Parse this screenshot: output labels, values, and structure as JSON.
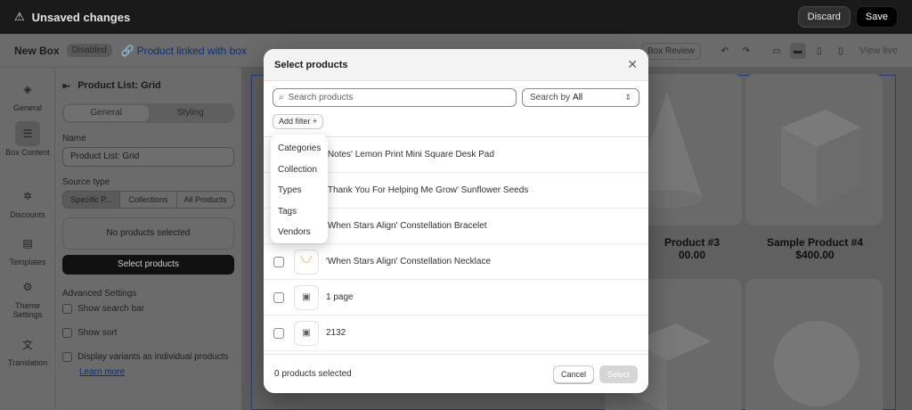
{
  "topbar": {
    "title": "Unsaved changes",
    "discard": "Discard",
    "save": "Save"
  },
  "subbar": {
    "box_name": "New Box",
    "status_badge": "Disabled",
    "product_link": "Product linked with box",
    "box_review": "Box Review",
    "view_live": "View live"
  },
  "rail": [
    {
      "label": "General",
      "icon": "cube-icon"
    },
    {
      "label": "Box Content",
      "icon": "list-icon"
    },
    {
      "label": "Discounts",
      "icon": "discount-icon"
    },
    {
      "label": "Templates",
      "icon": "template-icon"
    },
    {
      "label": "Theme Settings",
      "icon": "gear-icon"
    },
    {
      "label": "Translation",
      "icon": "translate-icon"
    }
  ],
  "panel": {
    "title": "Product List: Grid",
    "tabs": [
      "General",
      "Styling"
    ],
    "name_label": "Name",
    "name_value": "Product List: Grid",
    "source_label": "Source type",
    "source_options": [
      "Specific P...",
      "Collections",
      "All Products"
    ],
    "empty_text": "No products selected",
    "select_button": "Select products",
    "advanced_label": "Advanced Settings",
    "options": [
      "Show search bar",
      "Show sort",
      "Display variants as individual products"
    ],
    "learn_more": "Learn more"
  },
  "preview": {
    "cards": [
      {
        "name": "Product #3",
        "price": "00.00"
      },
      {
        "name": "Sample Product #4",
        "price": "$400.00"
      }
    ]
  },
  "modal": {
    "title": "Select products",
    "search_placeholder": "Search products",
    "search_by_label": "Search by",
    "search_by_value": "All",
    "add_filter": "Add filter +",
    "products": [
      "'Notes' Lemon Print Mini Square Desk Pad",
      "'Thank You For Helping Me Grow' Sunflower Seeds",
      "'When Stars Align' Constellation Bracelet",
      "'When Stars Align' Constellation Necklace",
      "1 page",
      "2132"
    ],
    "selected_count": "0 products selected",
    "cancel": "Cancel",
    "select": "Select"
  },
  "filter_menu": [
    "Categories",
    "Collection",
    "Types",
    "Tags",
    "Vendors"
  ]
}
